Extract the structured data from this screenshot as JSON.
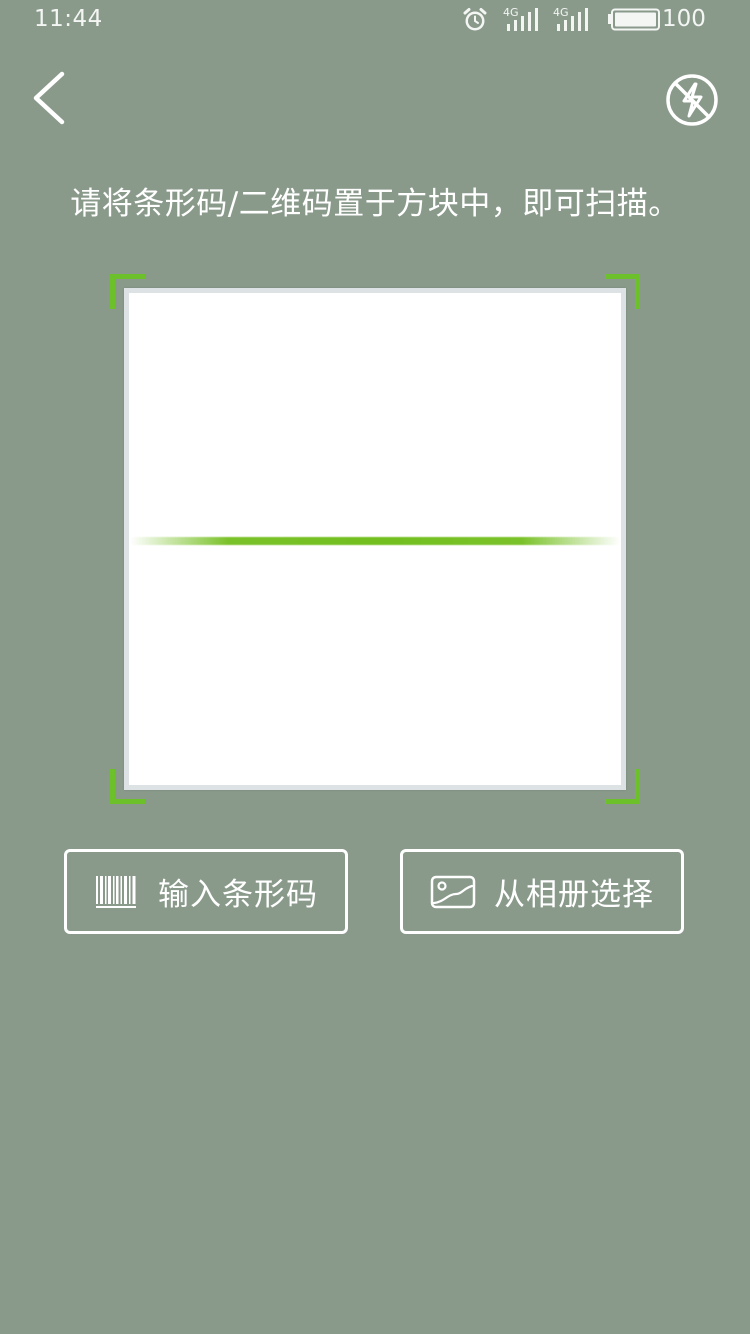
{
  "status_bar": {
    "time": "11:44",
    "network_1": "4G",
    "network_2": "4G",
    "battery_level": "100",
    "icons": [
      "alarm-icon",
      "signal-icon",
      "signal-icon",
      "battery-icon"
    ]
  },
  "header": {
    "back_icon": "chevron-left-icon",
    "flash_icon": "flash-off-icon"
  },
  "instruction": "请将条形码/二维码置于方块中，即可扫描。",
  "scanner": {
    "accent_color": "#6cc12b",
    "background_color": "#899a8b"
  },
  "actions": {
    "enter_barcode": {
      "icon": "barcode-icon",
      "label": "输入条形码"
    },
    "choose_from_album": {
      "icon": "image-icon",
      "label": "从相册选择"
    }
  }
}
